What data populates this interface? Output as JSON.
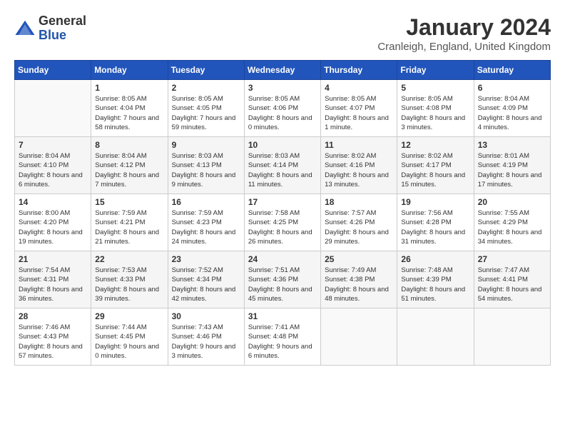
{
  "header": {
    "logo_line1": "General",
    "logo_line2": "Blue",
    "month": "January 2024",
    "location": "Cranleigh, England, United Kingdom"
  },
  "weekdays": [
    "Sunday",
    "Monday",
    "Tuesday",
    "Wednesday",
    "Thursday",
    "Friday",
    "Saturday"
  ],
  "weeks": [
    [
      {
        "day": "",
        "sunrise": "",
        "sunset": "",
        "daylight": ""
      },
      {
        "day": "1",
        "sunrise": "Sunrise: 8:05 AM",
        "sunset": "Sunset: 4:04 PM",
        "daylight": "Daylight: 7 hours and 58 minutes."
      },
      {
        "day": "2",
        "sunrise": "Sunrise: 8:05 AM",
        "sunset": "Sunset: 4:05 PM",
        "daylight": "Daylight: 7 hours and 59 minutes."
      },
      {
        "day": "3",
        "sunrise": "Sunrise: 8:05 AM",
        "sunset": "Sunset: 4:06 PM",
        "daylight": "Daylight: 8 hours and 0 minutes."
      },
      {
        "day": "4",
        "sunrise": "Sunrise: 8:05 AM",
        "sunset": "Sunset: 4:07 PM",
        "daylight": "Daylight: 8 hours and 1 minute."
      },
      {
        "day": "5",
        "sunrise": "Sunrise: 8:05 AM",
        "sunset": "Sunset: 4:08 PM",
        "daylight": "Daylight: 8 hours and 3 minutes."
      },
      {
        "day": "6",
        "sunrise": "Sunrise: 8:04 AM",
        "sunset": "Sunset: 4:09 PM",
        "daylight": "Daylight: 8 hours and 4 minutes."
      }
    ],
    [
      {
        "day": "7",
        "sunrise": "Sunrise: 8:04 AM",
        "sunset": "Sunset: 4:10 PM",
        "daylight": "Daylight: 8 hours and 6 minutes."
      },
      {
        "day": "8",
        "sunrise": "Sunrise: 8:04 AM",
        "sunset": "Sunset: 4:12 PM",
        "daylight": "Daylight: 8 hours and 7 minutes."
      },
      {
        "day": "9",
        "sunrise": "Sunrise: 8:03 AM",
        "sunset": "Sunset: 4:13 PM",
        "daylight": "Daylight: 8 hours and 9 minutes."
      },
      {
        "day": "10",
        "sunrise": "Sunrise: 8:03 AM",
        "sunset": "Sunset: 4:14 PM",
        "daylight": "Daylight: 8 hours and 11 minutes."
      },
      {
        "day": "11",
        "sunrise": "Sunrise: 8:02 AM",
        "sunset": "Sunset: 4:16 PM",
        "daylight": "Daylight: 8 hours and 13 minutes."
      },
      {
        "day": "12",
        "sunrise": "Sunrise: 8:02 AM",
        "sunset": "Sunset: 4:17 PM",
        "daylight": "Daylight: 8 hours and 15 minutes."
      },
      {
        "day": "13",
        "sunrise": "Sunrise: 8:01 AM",
        "sunset": "Sunset: 4:19 PM",
        "daylight": "Daylight: 8 hours and 17 minutes."
      }
    ],
    [
      {
        "day": "14",
        "sunrise": "Sunrise: 8:00 AM",
        "sunset": "Sunset: 4:20 PM",
        "daylight": "Daylight: 8 hours and 19 minutes."
      },
      {
        "day": "15",
        "sunrise": "Sunrise: 7:59 AM",
        "sunset": "Sunset: 4:21 PM",
        "daylight": "Daylight: 8 hours and 21 minutes."
      },
      {
        "day": "16",
        "sunrise": "Sunrise: 7:59 AM",
        "sunset": "Sunset: 4:23 PM",
        "daylight": "Daylight: 8 hours and 24 minutes."
      },
      {
        "day": "17",
        "sunrise": "Sunrise: 7:58 AM",
        "sunset": "Sunset: 4:25 PM",
        "daylight": "Daylight: 8 hours and 26 minutes."
      },
      {
        "day": "18",
        "sunrise": "Sunrise: 7:57 AM",
        "sunset": "Sunset: 4:26 PM",
        "daylight": "Daylight: 8 hours and 29 minutes."
      },
      {
        "day": "19",
        "sunrise": "Sunrise: 7:56 AM",
        "sunset": "Sunset: 4:28 PM",
        "daylight": "Daylight: 8 hours and 31 minutes."
      },
      {
        "day": "20",
        "sunrise": "Sunrise: 7:55 AM",
        "sunset": "Sunset: 4:29 PM",
        "daylight": "Daylight: 8 hours and 34 minutes."
      }
    ],
    [
      {
        "day": "21",
        "sunrise": "Sunrise: 7:54 AM",
        "sunset": "Sunset: 4:31 PM",
        "daylight": "Daylight: 8 hours and 36 minutes."
      },
      {
        "day": "22",
        "sunrise": "Sunrise: 7:53 AM",
        "sunset": "Sunset: 4:33 PM",
        "daylight": "Daylight: 8 hours and 39 minutes."
      },
      {
        "day": "23",
        "sunrise": "Sunrise: 7:52 AM",
        "sunset": "Sunset: 4:34 PM",
        "daylight": "Daylight: 8 hours and 42 minutes."
      },
      {
        "day": "24",
        "sunrise": "Sunrise: 7:51 AM",
        "sunset": "Sunset: 4:36 PM",
        "daylight": "Daylight: 8 hours and 45 minutes."
      },
      {
        "day": "25",
        "sunrise": "Sunrise: 7:49 AM",
        "sunset": "Sunset: 4:38 PM",
        "daylight": "Daylight: 8 hours and 48 minutes."
      },
      {
        "day": "26",
        "sunrise": "Sunrise: 7:48 AM",
        "sunset": "Sunset: 4:39 PM",
        "daylight": "Daylight: 8 hours and 51 minutes."
      },
      {
        "day": "27",
        "sunrise": "Sunrise: 7:47 AM",
        "sunset": "Sunset: 4:41 PM",
        "daylight": "Daylight: 8 hours and 54 minutes."
      }
    ],
    [
      {
        "day": "28",
        "sunrise": "Sunrise: 7:46 AM",
        "sunset": "Sunset: 4:43 PM",
        "daylight": "Daylight: 8 hours and 57 minutes."
      },
      {
        "day": "29",
        "sunrise": "Sunrise: 7:44 AM",
        "sunset": "Sunset: 4:45 PM",
        "daylight": "Daylight: 9 hours and 0 minutes."
      },
      {
        "day": "30",
        "sunrise": "Sunrise: 7:43 AM",
        "sunset": "Sunset: 4:46 PM",
        "daylight": "Daylight: 9 hours and 3 minutes."
      },
      {
        "day": "31",
        "sunrise": "Sunrise: 7:41 AM",
        "sunset": "Sunset: 4:48 PM",
        "daylight": "Daylight: 9 hours and 6 minutes."
      },
      {
        "day": "",
        "sunrise": "",
        "sunset": "",
        "daylight": ""
      },
      {
        "day": "",
        "sunrise": "",
        "sunset": "",
        "daylight": ""
      },
      {
        "day": "",
        "sunrise": "",
        "sunset": "",
        "daylight": ""
      }
    ]
  ]
}
